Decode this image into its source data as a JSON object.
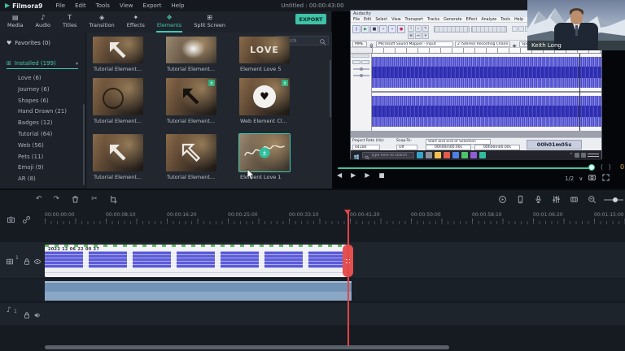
{
  "colors": {
    "accent": "#3fc2a7",
    "playhead": "#e04545",
    "waveform": "#5555cd",
    "clip_frame": "#5b5bd8",
    "audio_band": "#7292b6",
    "export_bg": "#3fc2a7"
  },
  "icons": {
    "tab_glyphs": [
      "▤",
      "♪",
      "T",
      "◈",
      "✦",
      "❖",
      "⊞"
    ],
    "heart": "♥",
    "grid": "⊞",
    "caret": "▾",
    "note": "♪",
    "minimize": "─",
    "maximize": "□",
    "close": "✕",
    "brackets": "( )",
    "chevron_down": "∨",
    "tray_chevron": "^"
  },
  "app": {
    "brand": "Filmora9",
    "title": "Untitled : 00:00:43:00",
    "menus": [
      "File",
      "Edit",
      "Tools",
      "View",
      "Export",
      "Help"
    ]
  },
  "tabs": {
    "items": [
      "Media",
      "Audio",
      "Titles",
      "Transition",
      "Effects",
      "Elements",
      "Split Screen"
    ],
    "active_index": 5,
    "export_label": "EXPORT"
  },
  "sidebar": {
    "favorites": "Favorites (0)",
    "installed": "Installed (199)",
    "categories": [
      "Love (6)",
      "Journey (6)",
      "Shapes (6)",
      "Hand Drawn (21)",
      "Badges (12)",
      "Tutorial (64)",
      "Web (56)",
      "Pets (11)",
      "Emoji (9)",
      "AR (8)"
    ]
  },
  "elements_panel": {
    "search_placeholder": "Search",
    "cards": [
      {
        "label": "Tutorial Element...",
        "art": "white-arrow"
      },
      {
        "label": "Tutorial Element...",
        "art": "mountain-light"
      },
      {
        "label": "Element Love 5",
        "art": "love-text",
        "overlay": "LOVE"
      },
      {
        "label": "Tutorial Element...",
        "art": "magnifier"
      },
      {
        "label": "Tutorial Element...",
        "art": "black-arrow",
        "badge": true
      },
      {
        "label": "Web Element Cl...",
        "art": "heart-circle",
        "badge": true
      },
      {
        "label": "Tutorial Element...",
        "art": "white-arrow"
      },
      {
        "label": "Tutorial Element...",
        "art": "outline-arrow"
      },
      {
        "label": "Element Love 1",
        "art": "script",
        "selected": true
      }
    ]
  },
  "preview": {
    "webcam_label": "Keith Long",
    "speed": "1/2",
    "controls": [
      {
        "name": "step-backward",
        "glyph": "◀"
      },
      {
        "name": "play",
        "glyph": "▶"
      },
      {
        "name": "step-forward",
        "glyph": "▶"
      },
      {
        "name": "stop",
        "glyph": "■"
      }
    ]
  },
  "audacity": {
    "title": "Audacity",
    "menus": [
      "File",
      "Edit",
      "Select",
      "View",
      "Transport",
      "Tracks",
      "Generate",
      "Effect",
      "Analyze",
      "Tools",
      "Help"
    ],
    "transport": [
      {
        "name": "pause",
        "glyph": "∥",
        "color": "#3c55c0"
      },
      {
        "name": "play",
        "glyph": "▶",
        "color": "#259b3e"
      },
      {
        "name": "stop",
        "glyph": "■",
        "color": "#3a3a4a"
      },
      {
        "name": "skip-to-start",
        "glyph": "«",
        "color": "#8040b8"
      },
      {
        "name": "skip-to-end",
        "glyph": "»",
        "color": "#8040b8"
      },
      {
        "name": "record",
        "glyph": "●",
        "color": "#cf2a62"
      }
    ],
    "tools": [
      "I",
      "⌣",
      "✎",
      "⊕",
      "↔",
      "✳"
    ],
    "host": "MME",
    "input_device": "Microsoft Sound Mapper - Input",
    "channels": "2 (Stereo) Recording Chann...",
    "output_device": "Speakers (Realtek High Defi...",
    "project_rate_label": "Project Rate (Hz):",
    "project_rate": "44100",
    "snap_label": "Snap-To:",
    "snap_value": "Off",
    "selection_label": "Start and End of Selection",
    "sel_start": "00h00m00.00s",
    "sel_end": "00h00m00.00s",
    "position": "00h01m05s"
  },
  "taskbar": {
    "search_placeholder": "Type here to search",
    "app_icons": [
      {
        "name": "cortana",
        "color": "#35a4c8"
      },
      {
        "name": "task-view",
        "color": "#8a8f9a"
      },
      {
        "name": "file-explorer",
        "color": "#f2c14e"
      },
      {
        "name": "browser",
        "color": "#e25c4a"
      },
      {
        "name": "app-blue",
        "color": "#4e7fe4"
      },
      {
        "name": "app-green",
        "color": "#4ec46a"
      },
      {
        "name": "app-purple",
        "color": "#8e5ed6"
      },
      {
        "name": "app-teal",
        "color": "#2fbf9c"
      }
    ]
  },
  "timeline": {
    "ruler": [
      "00:00:00:00",
      "00:00:08:10",
      "00:00:16:20",
      "00:00:25:00",
      "00:00:33:10",
      "00:00:41:20",
      "00:00:50:00",
      "00:00:58:10",
      "00:01:06:20",
      "00:01:15:00"
    ],
    "clip_label": "2022 12 06 22 00 37",
    "video_track_num": "1",
    "audio_track_num": "1",
    "left_tools": [
      {
        "name": "undo-icon",
        "glyph": "↶"
      },
      {
        "name": "redo-icon",
        "glyph": "↷"
      },
      {
        "name": "delete-icon",
        "icon": "trash"
      },
      {
        "name": "split-scissors-icon",
        "glyph": "✂"
      },
      {
        "name": "crop-icon",
        "icon": "crop"
      }
    ],
    "right_tools": [
      {
        "name": "render-preview-icon",
        "icon": "playcircle"
      },
      {
        "name": "connect-device-icon",
        "icon": "phone"
      },
      {
        "name": "record-voiceover-icon",
        "icon": "mic"
      },
      {
        "name": "audio-mixer-icon",
        "icon": "mixer"
      },
      {
        "name": "marker-icon",
        "icon": "marker"
      },
      {
        "name": "zoom-out-icon",
        "icon": "zoomout"
      }
    ]
  }
}
